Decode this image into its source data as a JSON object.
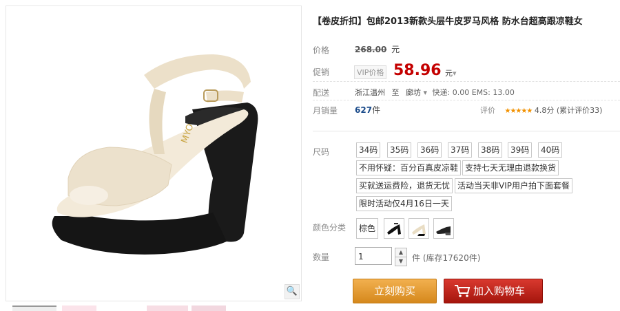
{
  "product": {
    "title": "【卷皮折扣】包邮2013新款头层牛皮罗马风格 防水台超高跟凉鞋女"
  },
  "price": {
    "label": "价格",
    "original": "268.00",
    "currency": "元"
  },
  "promo": {
    "label": "促销",
    "vip_tag": "VIP价格",
    "value": "58.96",
    "currency": "元",
    "caret": "▾"
  },
  "delivery": {
    "label": "配送",
    "from": "浙江温州",
    "to_word": "至",
    "destination": "廊坊",
    "shipping": "快递: 0.00 EMS: 13.00"
  },
  "sales": {
    "label": "月销量",
    "count": "627",
    "unit": "件",
    "rating_label": "评价",
    "stars": "★★★★★",
    "score": "4.8分",
    "review_count": "(累计评价33)"
  },
  "size": {
    "label": "尺码",
    "options": [
      "34码",
      "35码",
      "36码",
      "37码",
      "38码",
      "39码",
      "40码"
    ]
  },
  "service_tags": [
    "不用怀疑：百分百真皮凉鞋",
    "支持七天无理由退款换货",
    "买就送运费险，退货无忧",
    "活动当天非VIP用户拍下面套餐",
    "限时活动仅4月16日一天"
  ],
  "color": {
    "label": "颜色分类",
    "selected_text": "棕色"
  },
  "quantity": {
    "label": "数量",
    "value": "1",
    "unit": "件",
    "stock": "(库存17620件)"
  },
  "actions": {
    "buy_now": "立刻购买",
    "add_to_cart": "加入购物车"
  },
  "icons": {
    "zoom": "search-icon",
    "cart": "cart-icon"
  },
  "colors": {
    "price_red": "#c40000",
    "buy_orange": "#e29d35",
    "cart_red": "#c62219",
    "star_orange": "#f29100"
  }
}
